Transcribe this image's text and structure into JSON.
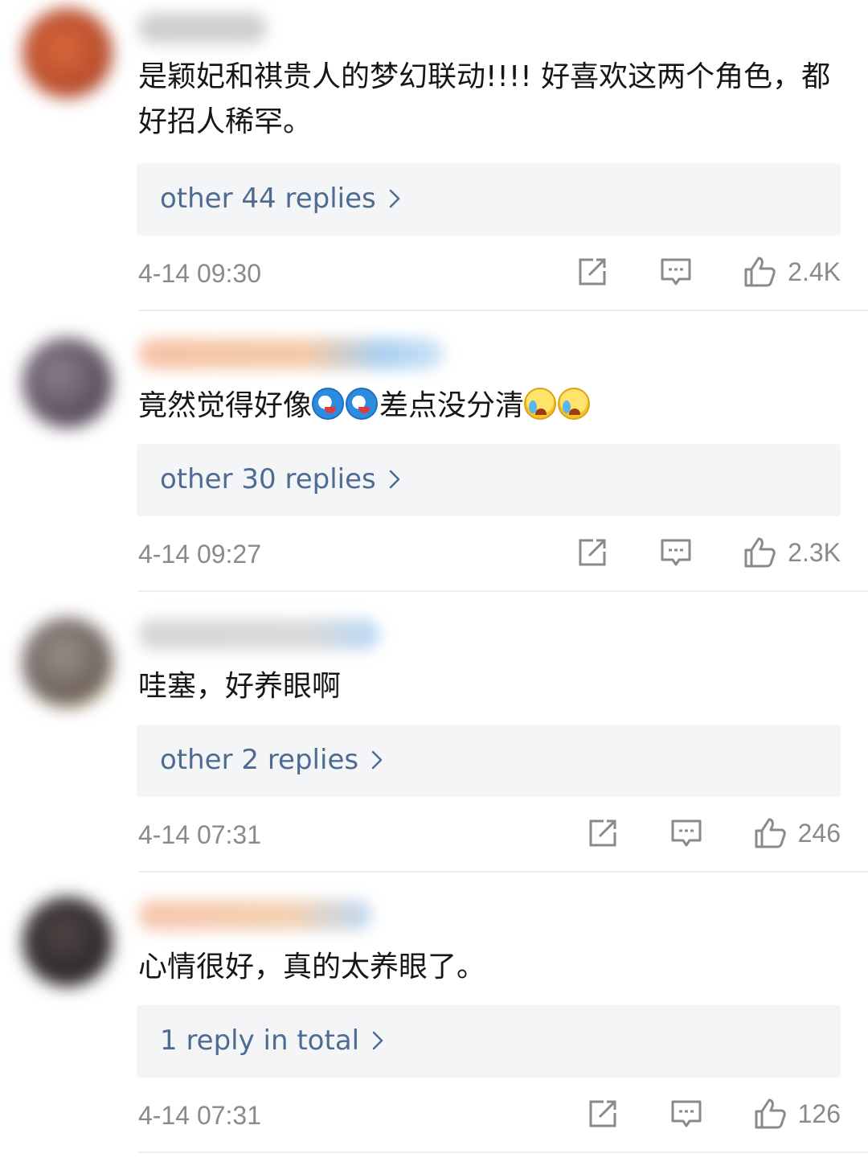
{
  "comments": [
    {
      "text": "是颖妃和祺贵人的梦幻联动!!!! 好喜欢这两个角色，都好招人稀罕。",
      "replies_label": "other 44 replies",
      "time": "4-14 09:30",
      "likes": "2.4K"
    },
    {
      "text_before": "竟然觉得好像",
      "text_middle": "差点没分清",
      "emoji_set_1": [
        "doraemon-emoji",
        "doraemon-emoji"
      ],
      "emoji_set_2": [
        "crying-laughing-emoji",
        "crying-laughing-emoji"
      ],
      "replies_label": "other 30 replies",
      "time": "4-14 09:27",
      "likes": "2.3K"
    },
    {
      "text": "哇塞，好养眼啊",
      "replies_label": "other 2 replies",
      "time": "4-14 07:31",
      "likes": "246"
    },
    {
      "text": "心情很好，真的太养眼了。",
      "replies_label": "1 reply in total",
      "time": "4-14 07:31",
      "likes": "126"
    }
  ],
  "icons": {
    "share": "share-icon",
    "reply": "comment-icon",
    "like": "thumbs-up-icon",
    "more": "chevron-right-icon"
  },
  "colors": {
    "link": "#4e6c92",
    "meta": "#8a8a8a",
    "reply_box": "#f4f5f7"
  }
}
